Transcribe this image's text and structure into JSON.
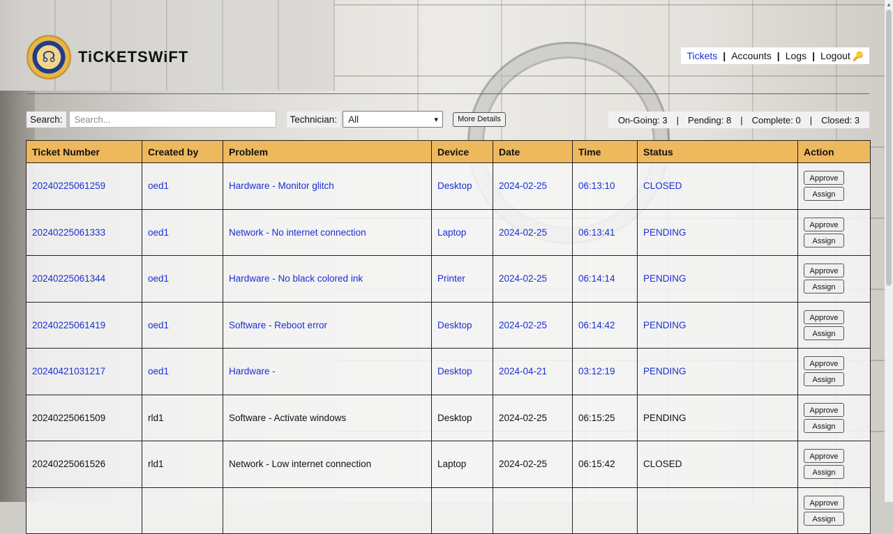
{
  "brand": {
    "name": "TiCKETSWiFT",
    "logo_icon": "racing-commission-seal-icon"
  },
  "nav": {
    "items": [
      {
        "label": "Tickets",
        "active": true
      },
      {
        "label": "Accounts",
        "active": false
      },
      {
        "label": "Logs",
        "active": false
      },
      {
        "label": "Logout",
        "active": false
      }
    ],
    "logout_icon": "key-icon"
  },
  "filters": {
    "search_label": "Search:",
    "search_placeholder": "Search...",
    "technician_label": "Technician:",
    "technician_value": "All",
    "more_details_label": "More Details"
  },
  "stats": {
    "ongoing": "On-Going: 3",
    "pending": "Pending: 8",
    "complete": "Complete: 0",
    "closed": "Closed: 3"
  },
  "table": {
    "headers": [
      "Ticket Number",
      "Created by",
      "Problem",
      "Device",
      "Date",
      "Time",
      "Status",
      "Action"
    ],
    "actions": {
      "approve": "Approve",
      "assign": "Assign"
    },
    "rows": [
      {
        "ticket": "20240225061259",
        "created_by": "oed1",
        "problem": "Hardware - Monitor glitch",
        "device": "Desktop",
        "date": "2024-02-25",
        "time": "06:13:10",
        "status": "CLOSED",
        "linked": true
      },
      {
        "ticket": "20240225061333",
        "created_by": "oed1",
        "problem": "Network - No internet connection",
        "device": "Laptop",
        "date": "2024-02-25",
        "time": "06:13:41",
        "status": "PENDING",
        "linked": true
      },
      {
        "ticket": "20240225061344",
        "created_by": "oed1",
        "problem": "Hardware - No black colored ink",
        "device": "Printer",
        "date": "2024-02-25",
        "time": "06:14:14",
        "status": "PENDING",
        "linked": true
      },
      {
        "ticket": "20240225061419",
        "created_by": "oed1",
        "problem": "Software - Reboot error",
        "device": "Desktop",
        "date": "2024-02-25",
        "time": "06:14:42",
        "status": "PENDING",
        "linked": true
      },
      {
        "ticket": "20240421031217",
        "created_by": "oed1",
        "problem": "Hardware -",
        "device": "Desktop",
        "date": "2024-04-21",
        "time": "03:12:19",
        "status": "PENDING",
        "linked": true
      },
      {
        "ticket": "20240225061509",
        "created_by": "rld1",
        "problem": "Software - Activate windows",
        "device": "Desktop",
        "date": "2024-02-25",
        "time": "06:15:25",
        "status": "PENDING",
        "linked": false
      },
      {
        "ticket": "20240225061526",
        "created_by": "rld1",
        "problem": "Network - Low internet connection",
        "device": "Laptop",
        "date": "2024-02-25",
        "time": "06:15:42",
        "status": "CLOSED",
        "linked": false
      },
      {
        "ticket": "",
        "created_by": "",
        "problem": "",
        "device": "",
        "date": "",
        "time": "",
        "status": "",
        "linked": false
      }
    ]
  },
  "colors": {
    "header_bg": "#eeb85c",
    "link": "#1a2fd1"
  }
}
